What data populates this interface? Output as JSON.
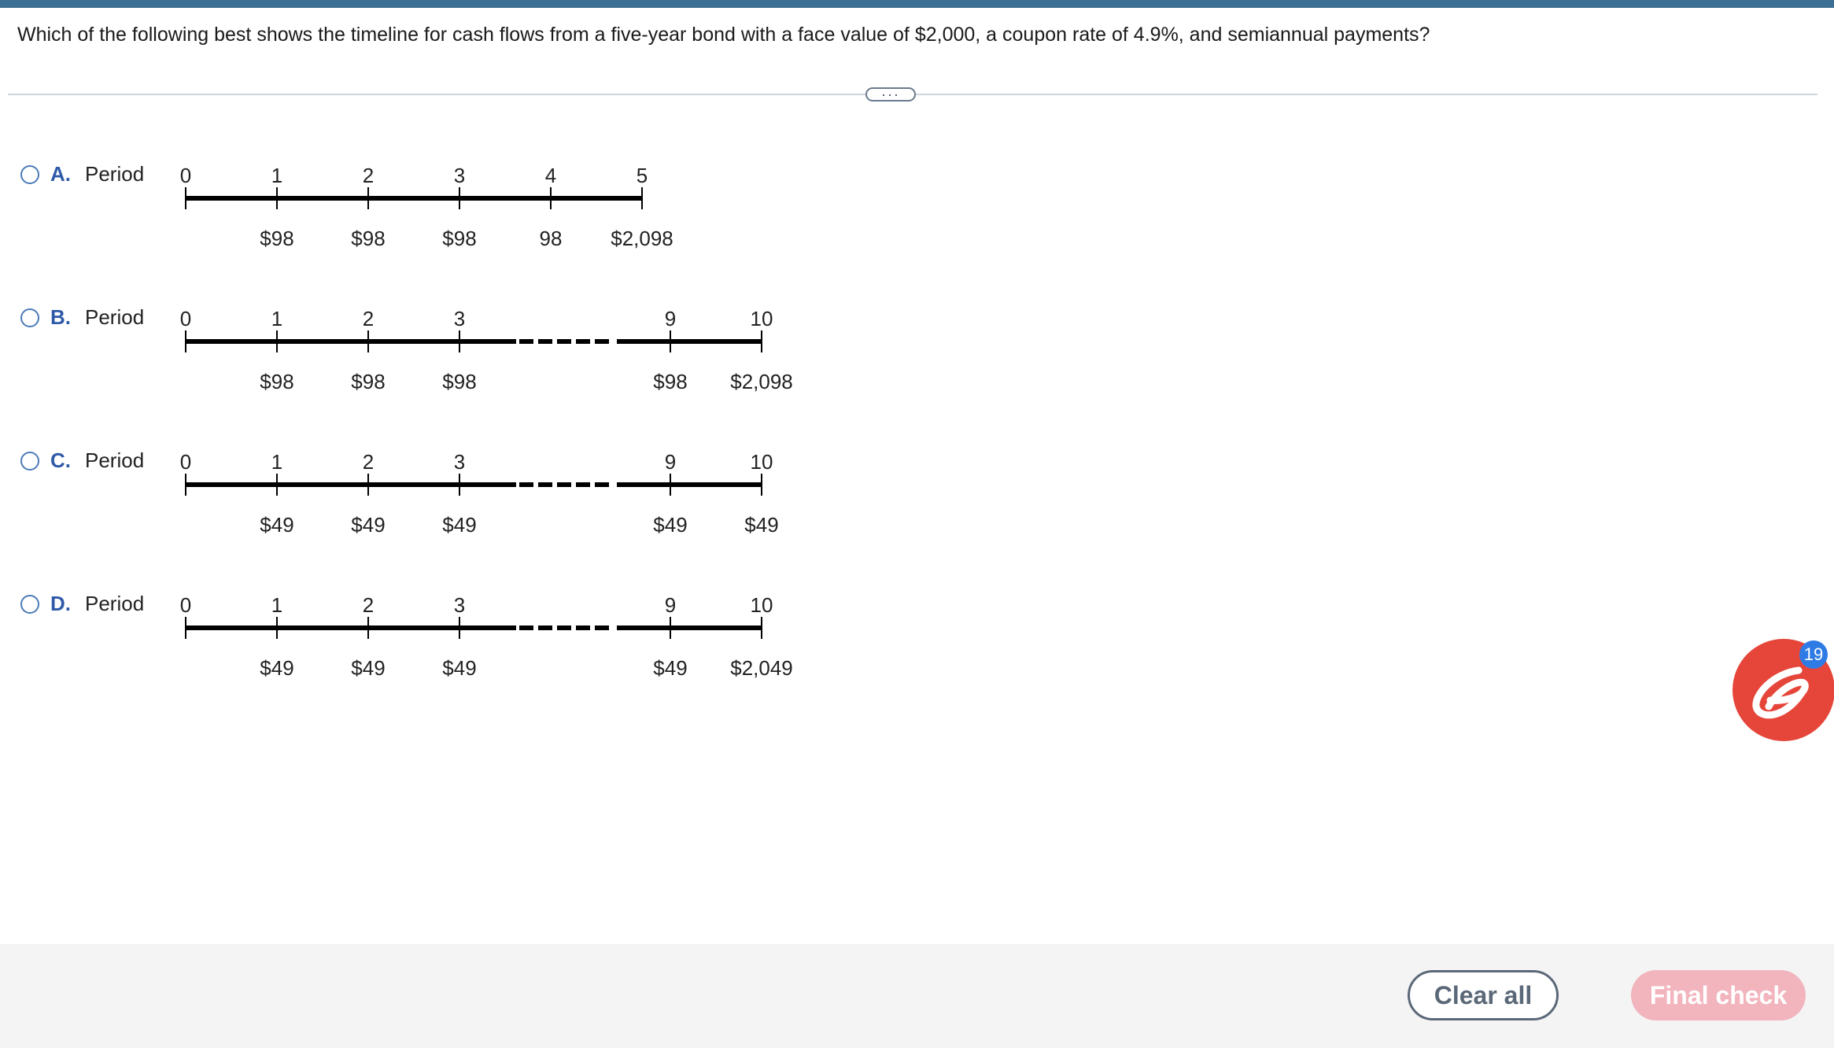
{
  "question": "Which of the following best shows the timeline for cash flows from a five-year bond with a face value of $2,000, a coupon rate of 4.9%, and semiannual payments?",
  "more_label": "···",
  "period_label": "Period",
  "options": [
    {
      "letter": "A.",
      "periods": [
        "0",
        "1",
        "2",
        "3",
        "4",
        "5"
      ],
      "flows": [
        "",
        "$98",
        "$98",
        "$98",
        "98",
        "$2,098"
      ],
      "broken": false
    },
    {
      "letter": "B.",
      "periods": [
        "0",
        "1",
        "2",
        "3",
        "9",
        "10"
      ],
      "flows": [
        "",
        "$98",
        "$98",
        "$98",
        "$98",
        "$2,098"
      ],
      "broken": true
    },
    {
      "letter": "C.",
      "periods": [
        "0",
        "1",
        "2",
        "3",
        "9",
        "10"
      ],
      "flows": [
        "",
        "$49",
        "$49",
        "$49",
        "$49",
        "$49"
      ],
      "broken": true
    },
    {
      "letter": "D.",
      "periods": [
        "0",
        "1",
        "2",
        "3",
        "9",
        "10"
      ],
      "flows": [
        "",
        "$49",
        "$49",
        "$49",
        "$49",
        "$2,049"
      ],
      "broken": true
    }
  ],
  "footer": {
    "clear_label": "Clear all",
    "final_label": "Final check"
  },
  "helper": {
    "badge_count": "19",
    "icon": "e-helper-icon"
  }
}
